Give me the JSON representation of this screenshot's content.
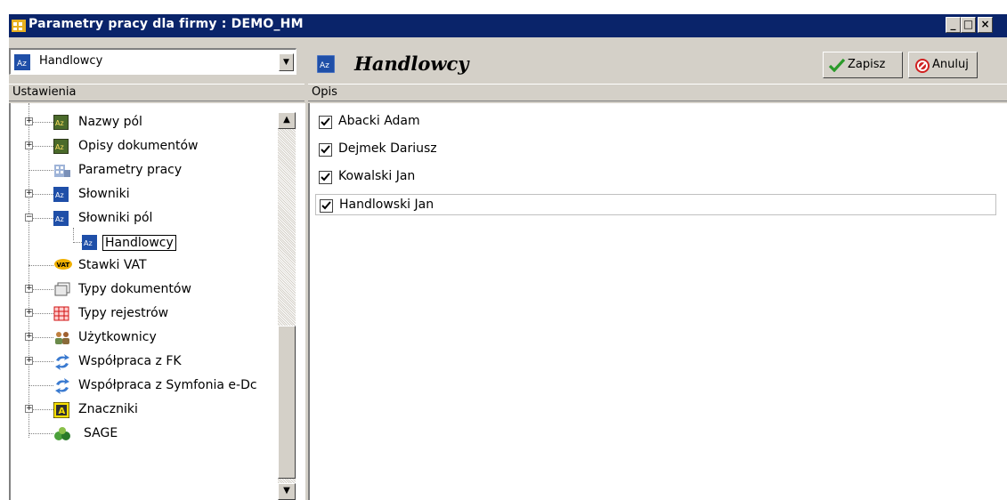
{
  "window": {
    "title": "Parametry pracy dla firmy : DEMO_HM",
    "buttons": {
      "minimize": "_",
      "maximize": "□",
      "close": "×"
    }
  },
  "left": {
    "combo_value": "Handlowcy",
    "header": "Ustawienia",
    "tree": [
      {
        "label": "Nazwy pól",
        "icon": "az-dark-icon",
        "expandable": true
      },
      {
        "label": "Opisy dokumentów",
        "icon": "az-dark-icon",
        "expandable": true
      },
      {
        "label": "Parametry pracy",
        "icon": "building-icon",
        "expandable": false
      },
      {
        "label": "Słowniki",
        "icon": "az-blue-icon",
        "expandable": true
      },
      {
        "label": "Słowniki pól",
        "icon": "az-blue-icon",
        "expandable": true,
        "expanded": true
      },
      {
        "label": "Handlowcy",
        "icon": "az-blue-icon",
        "child": true,
        "selected": true
      },
      {
        "label": "Stawki VAT",
        "icon": "vat-icon",
        "expandable": false
      },
      {
        "label": "Typy dokumentów",
        "icon": "documents-icon",
        "expandable": true
      },
      {
        "label": "Typy rejestrów",
        "icon": "grid-icon",
        "expandable": true
      },
      {
        "label": "Użytkownicy",
        "icon": "users-icon",
        "expandable": true
      },
      {
        "label": "Współpraca z FK",
        "icon": "sync-icon",
        "expandable": true
      },
      {
        "label": "Współpraca z Symfonia e-Dc",
        "icon": "sync-icon",
        "expandable": false
      },
      {
        "label": "Znaczniki",
        "icon": "tag-icon",
        "expandable": true
      },
      {
        "label": "SAGE",
        "icon": "sage-icon",
        "expandable": false
      }
    ]
  },
  "right": {
    "title": "Handlowcy",
    "save_label": "Zapisz",
    "cancel_label": "Anuluj",
    "header": "Opis",
    "items": [
      {
        "label": "Abacki Adam",
        "checked": true
      },
      {
        "label": "Dejmek Dariusz",
        "checked": true
      },
      {
        "label": "Kowalski Jan",
        "checked": true
      },
      {
        "label": "Handlowski Jan",
        "checked": true,
        "selected": true
      }
    ]
  },
  "colors": {
    "titlebar": "#0a246a",
    "face": "#d4d0c8",
    "accent_blue": "#1f4fa8",
    "save_green": "#2a9a2a",
    "cancel_red": "#d02020"
  }
}
